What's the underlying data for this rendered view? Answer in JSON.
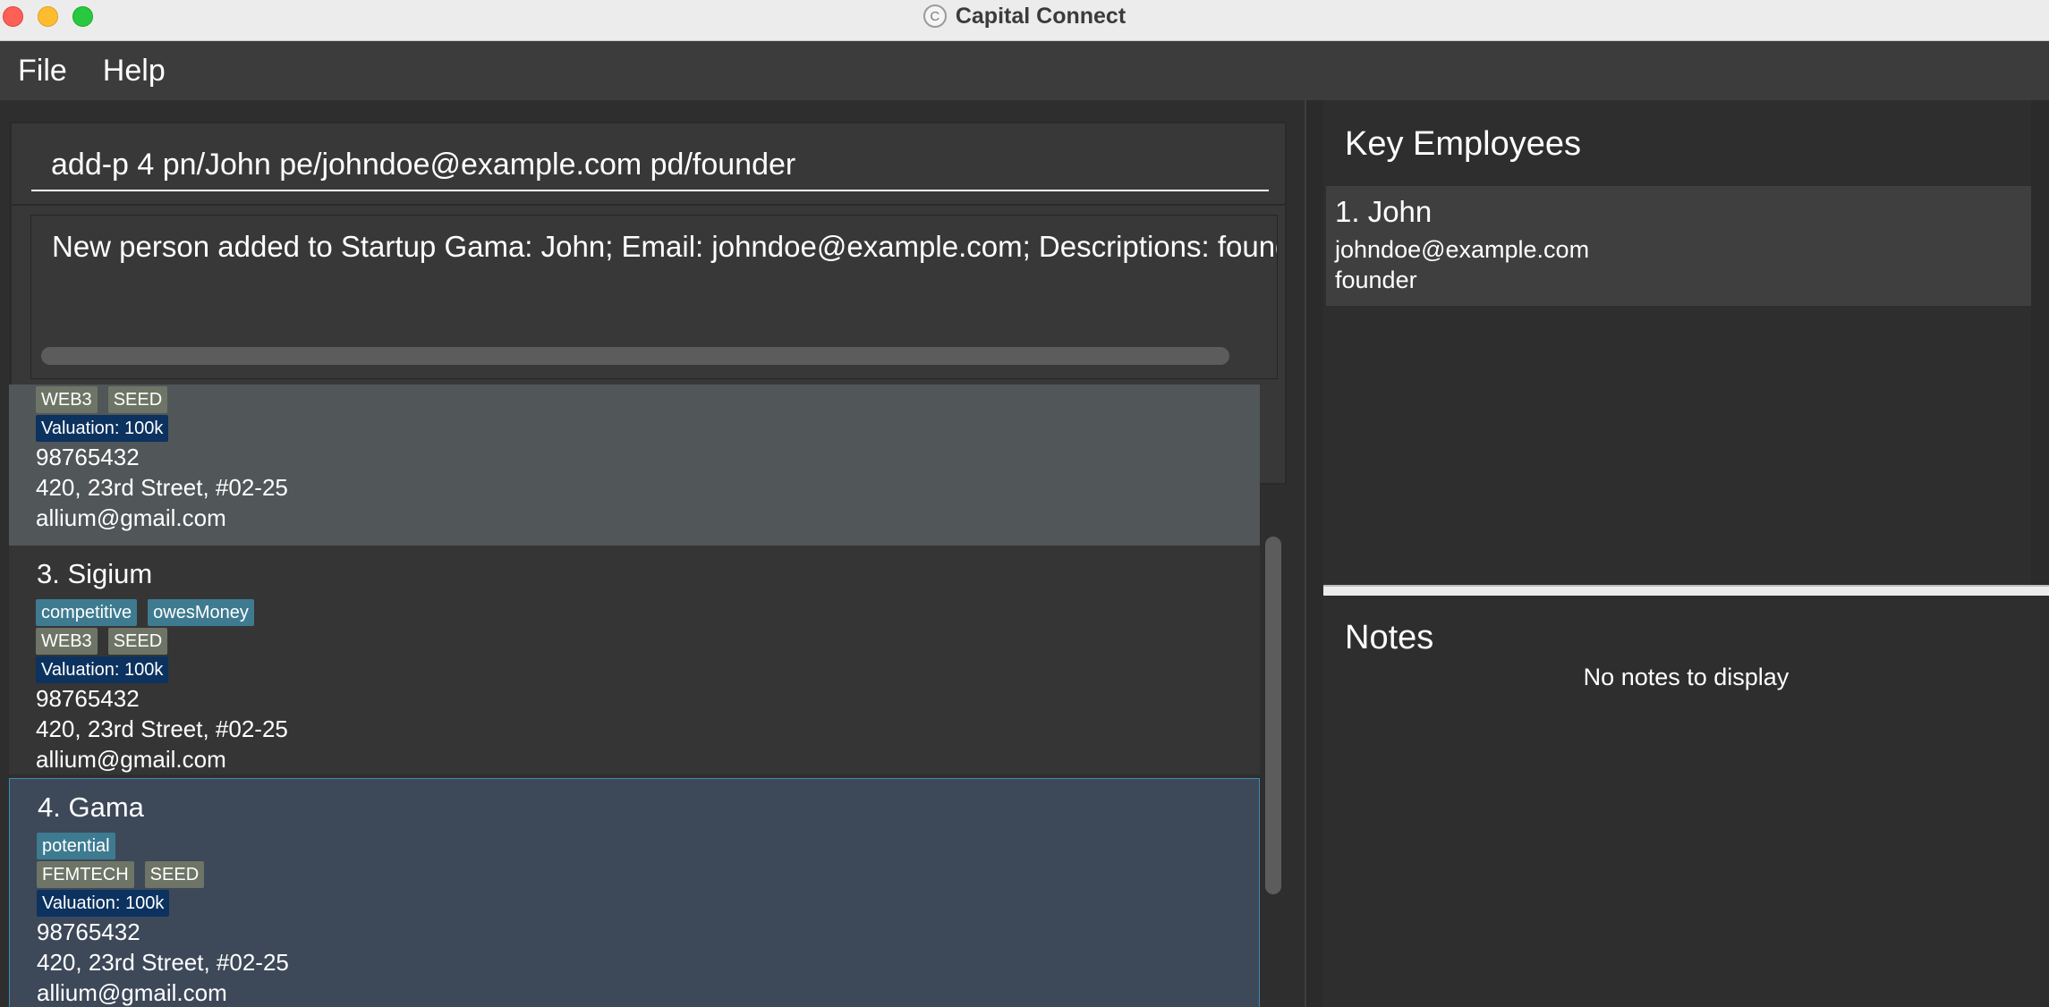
{
  "window": {
    "title": "Capital Connect"
  },
  "menu": {
    "file": "File",
    "help": "Help"
  },
  "command": {
    "value": "add-p 4 pn/John pe/johndoe@example.com pd/founder"
  },
  "result": {
    "text": "New person added to Startup Gama: John; Email: johndoe@example.com; Descriptions: founder"
  },
  "startups": [
    {
      "name": "",
      "tags_row1": [],
      "tags_row2": [
        "WEB3",
        "SEED"
      ],
      "valuation": "Valuation: 100k",
      "phone": "98765432",
      "address": "420, 23rd Street, #02-25",
      "email": "allium@gmail.com"
    },
    {
      "name": "3.  Sigium",
      "tags_row1": [
        "competitive",
        "owesMoney"
      ],
      "tags_row2": [
        "WEB3",
        "SEED"
      ],
      "valuation": "Valuation: 100k",
      "phone": "98765432",
      "address": "420, 23rd Street, #02-25",
      "email": "allium@gmail.com"
    },
    {
      "name": "4.  Gama",
      "tags_row1": [
        "potential"
      ],
      "tags_row2": [
        "FEMTECH",
        "SEED"
      ],
      "valuation": "Valuation: 100k",
      "phone": "98765432",
      "address": "420, 23rd Street, #02-25",
      "email": "allium@gmail.com"
    }
  ],
  "key_employees": {
    "heading": "Key Employees",
    "items": [
      {
        "name": "1. John",
        "email": "johndoe@example.com",
        "description": "founder"
      }
    ]
  },
  "notes": {
    "heading": "Notes",
    "empty_text": "No notes to display"
  },
  "colors": {
    "selected_card": "#3d4859",
    "tag_blue": "#3e7b91",
    "tag_olive": "#6e7566",
    "tag_navy": "#0c325f"
  }
}
